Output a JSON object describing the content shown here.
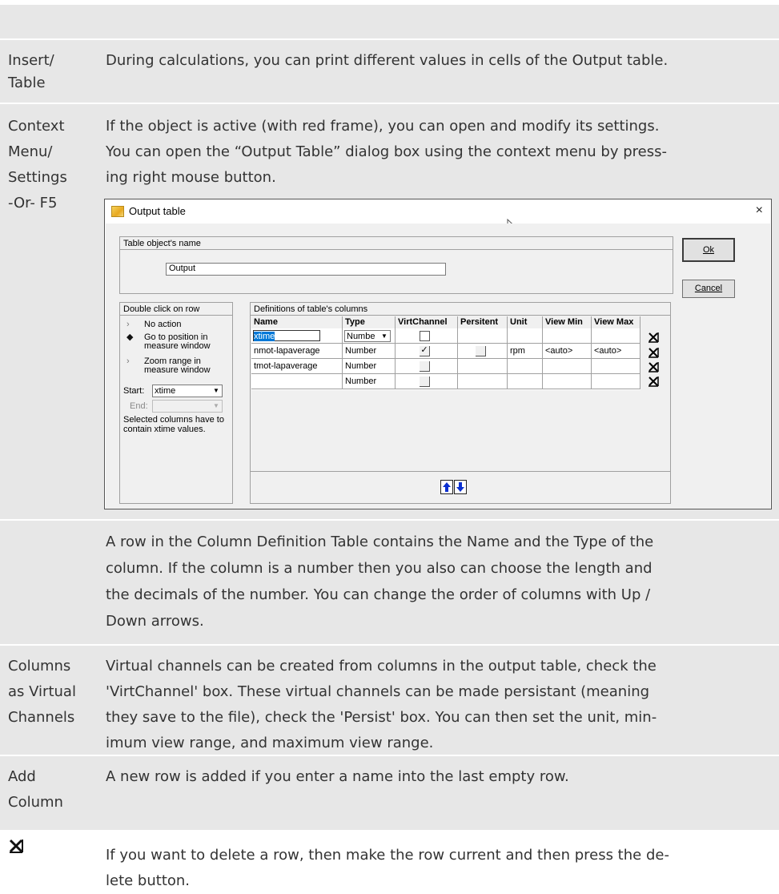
{
  "rows": {
    "insert_table": {
      "key": [
        "Insert/",
        "Table"
      ],
      "desc": "During calculations, you can print different values in cells of the Output table."
    },
    "context_menu": {
      "key": [
        "Context",
        "Menu/",
        "Settings",
        "-Or- F5"
      ],
      "desc": [
        "If the object is active (with red frame), you can open and modify its settings.",
        "You can open the “Output Table” dialog box using the context menu by press-",
        "ing right mouse button."
      ]
    },
    "column_def": {
      "desc": [
        "A row in the Column Definition Table contains the Name and the Type of the",
        "column. If the column is a number then you also can choose the length and",
        "the decimals of the number. You can change the order of columns with Up /",
        "Down arrows."
      ]
    },
    "virtual": {
      "key": [
        "Columns",
        "as Virtual",
        "Channels"
      ],
      "desc": [
        "Virtual channels can be created from columns in the output table, check the",
        "'VirtChannel' box. These virtual channels can be made persistant (meaning",
        "they save to the file), check the 'Persist' box. You can then set the unit, min-",
        "imum view range, and maximum view range."
      ]
    },
    "add_column": {
      "key": [
        "Add",
        "Column"
      ],
      "desc": "A new row is added if you enter a name into the last empty row."
    },
    "delete_row": {
      "desc": [
        "If you want to delete a row, then make the row current and then press the de-",
        "lete button."
      ]
    }
  },
  "dialog": {
    "title": "Output table",
    "close_glyph": "×",
    "name_group_label": "Table object's name",
    "name_value": "Output",
    "ok_label": "Ok",
    "cancel_label": "Cancel",
    "dblclick_group_label": "Double click on row",
    "options": [
      {
        "mark": "›",
        "label": "No action"
      },
      {
        "mark": "◆",
        "label": "Go to position in measure window"
      },
      {
        "mark": "›",
        "label": "Zoom range in measure window"
      }
    ],
    "start_label": "Start:",
    "start_value": "xtime",
    "end_label": "End:",
    "end_value": "",
    "hint_text": "Selected columns have to contain xtime values.",
    "defs_group_label": "Definitions of table's columns",
    "columns": [
      "Name",
      "Type",
      "VirtChannel",
      "Persitent",
      "Unit",
      "View Min",
      "View Max"
    ],
    "table_rows": [
      {
        "name": "xtime",
        "type": "Numbe",
        "virt": "",
        "persist": "",
        "unit": "",
        "vmin": "",
        "vmax": ""
      },
      {
        "name": "nmot-lapaverage",
        "type": "Number",
        "virt": "✓",
        "persist": "",
        "unit": "rpm",
        "vmin": "<auto>",
        "vmax": "<auto>"
      },
      {
        "name": "tmot-lapaverage",
        "type": "Number",
        "virt": "",
        "persist": "",
        "unit": "",
        "vmin": "",
        "vmax": ""
      },
      {
        "name": "",
        "type": "Number",
        "virt": "",
        "persist": "",
        "unit": "",
        "vmin": "",
        "vmax": ""
      }
    ]
  }
}
